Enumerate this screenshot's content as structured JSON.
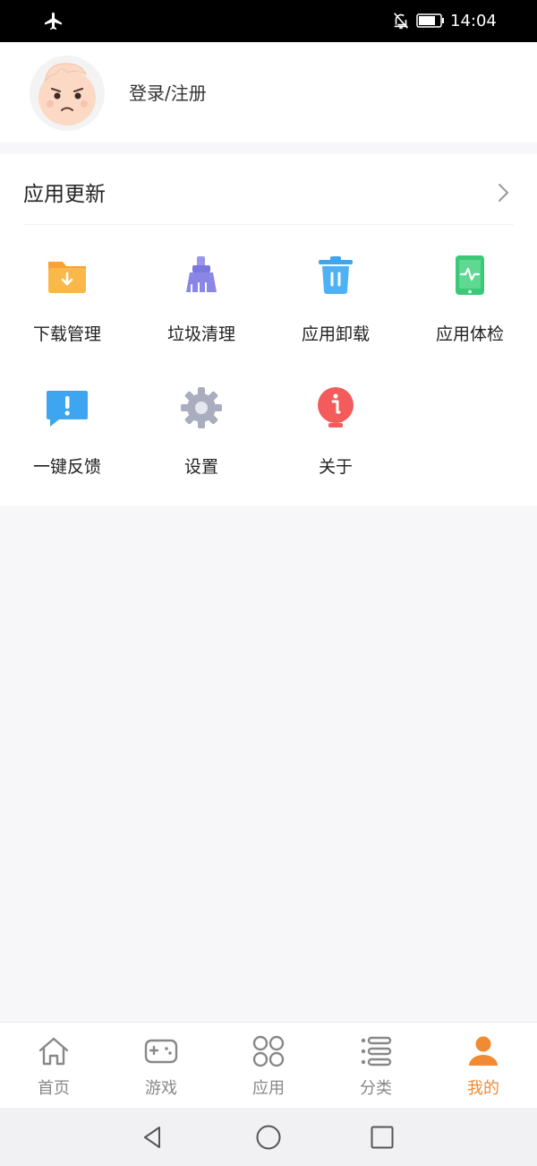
{
  "status_bar": {
    "time": "14:04",
    "icons": [
      "airplane-mode-icon",
      "notifications-off-icon",
      "battery-icon"
    ]
  },
  "profile": {
    "login_label": "登录/注册",
    "avatar_icon": "avatar-icon"
  },
  "update_section": {
    "title": "应用更新",
    "chevron_icon": "chevron-right-icon"
  },
  "tools": [
    {
      "label": "下载管理",
      "icon": "download-folder-icon",
      "color": "#f7a234"
    },
    {
      "label": "垃圾清理",
      "icon": "broom-icon",
      "color": "#7b77e0"
    },
    {
      "label": "应用卸载",
      "icon": "trash-icon",
      "color": "#3ea6f1"
    },
    {
      "label": "应用体检",
      "icon": "health-check-icon",
      "color": "#3cc977"
    },
    {
      "label": "一键反馈",
      "icon": "feedback-icon",
      "color": "#3ea6f1"
    },
    {
      "label": "设置",
      "icon": "gear-icon",
      "color": "#a9adbd"
    },
    {
      "label": "关于",
      "icon": "info-icon",
      "color": "#f45b5b"
    }
  ],
  "tabs": [
    {
      "label": "首页",
      "icon": "home-icon",
      "active": false
    },
    {
      "label": "游戏",
      "icon": "gamepad-icon",
      "active": false
    },
    {
      "label": "应用",
      "icon": "apps-icon",
      "active": false
    },
    {
      "label": "分类",
      "icon": "list-icon",
      "active": false
    },
    {
      "label": "我的",
      "icon": "person-icon",
      "active": true
    }
  ],
  "colors": {
    "accent": "#f08a33",
    "tab_inactive": "#888888",
    "background": "#f7f7f9"
  },
  "system_nav": [
    "back-icon",
    "home-circle-icon",
    "recents-icon"
  ]
}
